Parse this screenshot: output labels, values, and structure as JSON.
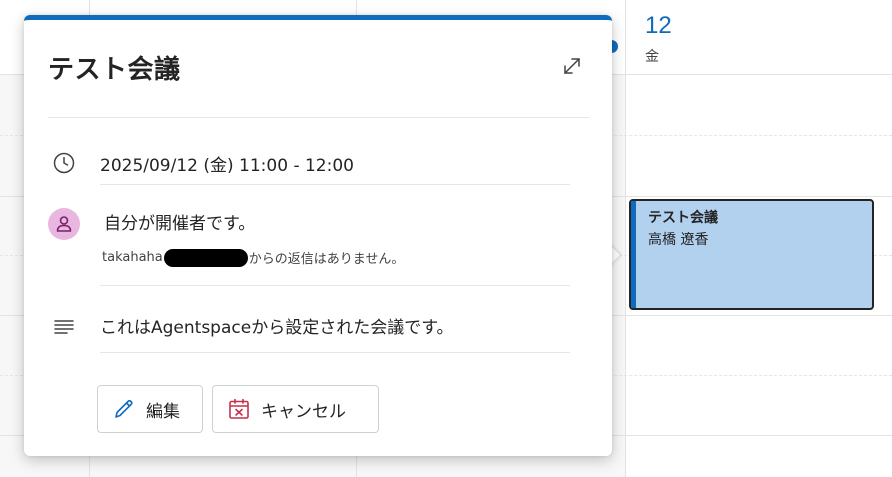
{
  "calendar": {
    "day_number": "12",
    "day_name": "金",
    "event": {
      "title": "テスト会議",
      "organizer": "高橋 遼香"
    }
  },
  "popup": {
    "title": "テスト会議",
    "datetime": "2025/09/12 (金) 11:00 - 12:00",
    "organizer_status": "自分が開催者です。",
    "response_prefix": "takahaha",
    "response_suffix": "からの返信はありません。",
    "description": "これはAgentspaceから設定された会議です。",
    "edit_label": "編集",
    "cancel_label": "キャンセル"
  },
  "icons": {
    "expand": "expand-icon",
    "clock": "clock-icon",
    "person": "person-icon",
    "text_lines": "text-lines-icon",
    "pencil": "pencil-icon",
    "calendar_cancel": "calendar-cancel-icon"
  },
  "colors": {
    "accent": "#0f6cbd",
    "event_fill": "#b1d1ef",
    "avatar": "#e9b6e0",
    "cancel_icon": "#c4314b"
  }
}
